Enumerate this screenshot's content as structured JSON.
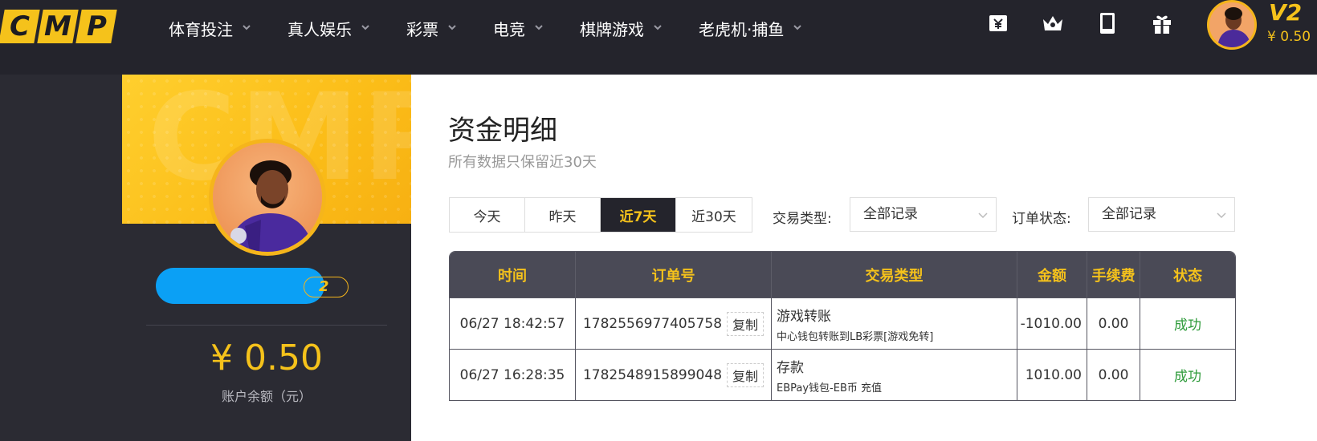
{
  "header": {
    "logo_letters": [
      "C",
      "M",
      "P"
    ],
    "nav": [
      {
        "label": "体育投注"
      },
      {
        "label": "真人娱乐"
      },
      {
        "label": "彩票"
      },
      {
        "label": "电竞"
      },
      {
        "label": "棋牌游戏"
      },
      {
        "label": "老虎机·捕鱼"
      }
    ],
    "icons": [
      "yuan-wallet-icon",
      "crown-icon",
      "tablet-icon",
      "gift-icon"
    ],
    "vip_level": "V2",
    "balance": "¥ 0.50"
  },
  "profile": {
    "vip_badge": "2",
    "balance": "¥ 0.50",
    "balance_label": "账户余额（元）"
  },
  "main": {
    "title": "资金明细",
    "subtitle": "所有数据只保留近30天",
    "range_tabs": [
      {
        "label": "今天",
        "active": false
      },
      {
        "label": "昨天",
        "active": false
      },
      {
        "label": "近7天",
        "active": true
      },
      {
        "label": "近30天",
        "active": false
      }
    ],
    "filters": {
      "type_label": "交易类型:",
      "type_value": "全部记录",
      "status_label": "订单状态:",
      "status_value": "全部记录"
    },
    "table": {
      "headers": [
        "时间",
        "订单号",
        "交易类型",
        "金额",
        "手续费",
        "状态"
      ],
      "copy_label": "复制",
      "rows": [
        {
          "time": "06/27 18:42:57",
          "order": "1782556977405758",
          "type": "游戏转账",
          "type_detail": "中心钱包转账到LB彩票[游戏免转]",
          "amount": "-1010.00",
          "fee": "0.00",
          "status": "成功"
        },
        {
          "time": "06/27 16:28:35",
          "order": "1782548915899048",
          "type": "存款",
          "type_detail": "EBPay钱包-EB币 充值",
          "amount": "1010.00",
          "fee": "0.00",
          "status": "成功"
        }
      ]
    }
  },
  "colors": {
    "accent": "#f5c21b",
    "dark": "#24242c",
    "table_head": "#4a4a56",
    "success": "#2e9b3a",
    "name_pill": "#0ba0f5"
  }
}
